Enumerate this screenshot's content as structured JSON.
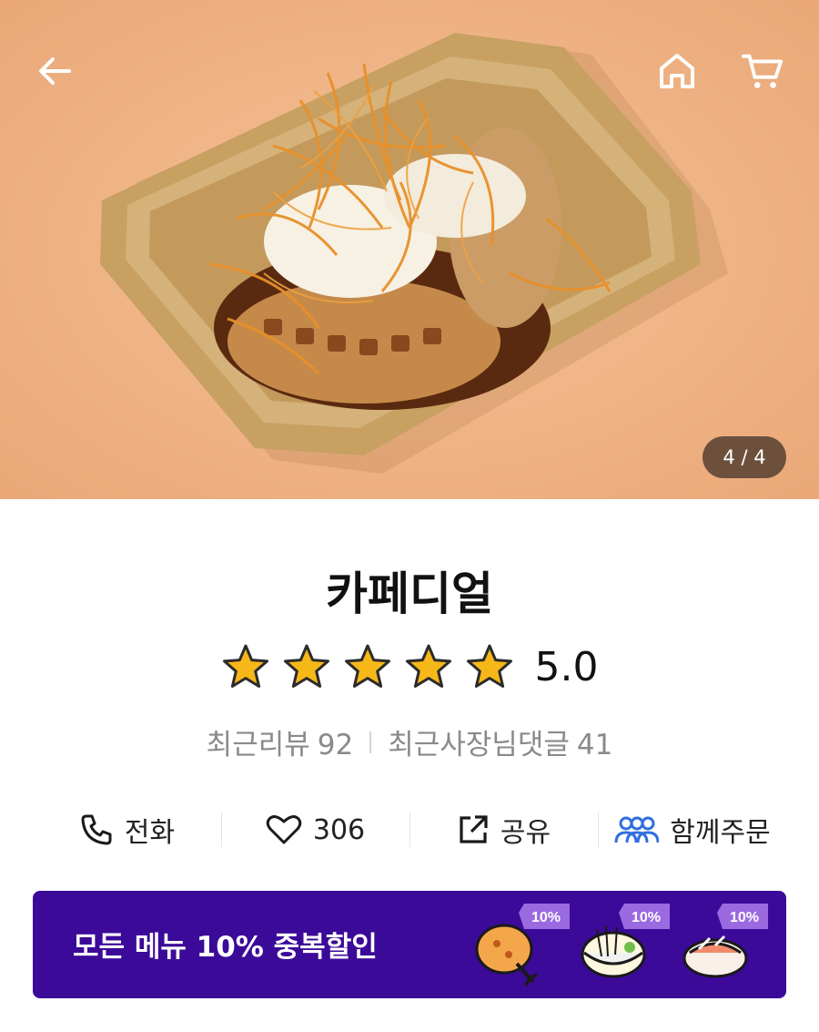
{
  "header": {
    "back_icon": "arrow-left-icon",
    "home_icon": "home-icon",
    "cart_icon": "cart-icon"
  },
  "gallery": {
    "counter": "4 / 4"
  },
  "store": {
    "name": "카페디얼",
    "rating": "5.0",
    "stars_filled": 5,
    "stars_total": 5,
    "recent_reviews_label": "최근리뷰",
    "recent_reviews_count": "92",
    "owner_replies_label": "최근사장님댓글",
    "owner_replies_count": "41"
  },
  "actions": {
    "call_label": "전화",
    "like_count": "306",
    "share_label": "공유",
    "group_order_label": "함께주문"
  },
  "banner": {
    "text": "모든 메뉴 10% 중복할인",
    "badge1": "10%",
    "badge2": "10%",
    "badge3": "10%"
  },
  "colors": {
    "hero_background": "#f2b88a",
    "banner_background": "#3b0a99",
    "star": "#f6b818",
    "group_icon": "#2f6fe0"
  }
}
